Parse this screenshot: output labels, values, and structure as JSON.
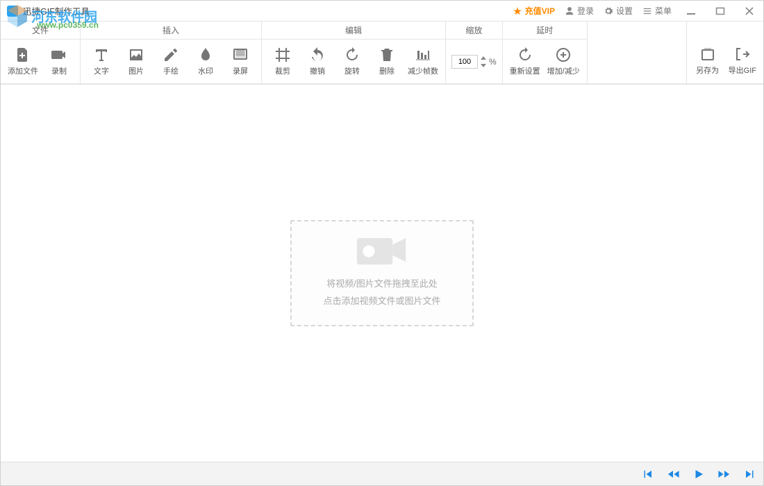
{
  "title": "迅捷GIF制作工具",
  "titlebar": {
    "vip": "充值VIP",
    "login": "登录",
    "settings": "设置",
    "menu": "菜单"
  },
  "ribbon": {
    "groups": {
      "file": {
        "title": "文件",
        "add_file": "添加文件",
        "record": "录制"
      },
      "insert": {
        "title": "插入",
        "text": "文字",
        "image": "图片",
        "draw": "手绘",
        "watermark": "水印",
        "screen_rec": "录屏"
      },
      "edit": {
        "title": "编辑",
        "crop": "裁剪",
        "undo": "撤销",
        "rotate": "旋转",
        "delete": "删除",
        "reduce_frames": "减少帧数"
      },
      "zoom": {
        "title": "缩放",
        "value": "100",
        "suffix": "%"
      },
      "delay": {
        "title": "延时",
        "reset": "重新设置",
        "inc_dec": "增加/减少"
      },
      "export": {
        "save_as": "另存为",
        "export_gif": "导出GIF"
      }
    }
  },
  "dropzone": {
    "line1": "将视频/图片文件拖拽至此处",
    "line2": "点击添加视频文件或图片文件"
  },
  "watermark": {
    "site_name": "河东软件园",
    "url": "www.pc0359.cn"
  }
}
